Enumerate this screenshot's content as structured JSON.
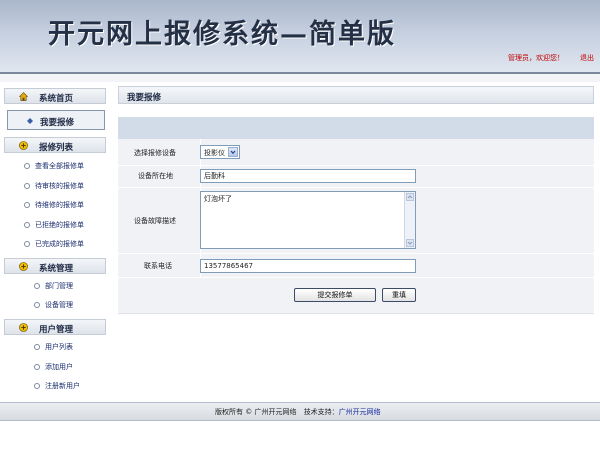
{
  "banner": {
    "title": "开元网上报修系统—简单版",
    "user_text": "管理员，欢迎您！",
    "logout": "退出"
  },
  "sidebar": {
    "home": "系统首页",
    "active": "我要报修",
    "sections": [
      {
        "label": "报修列表",
        "items": [
          "查看全部报修单",
          "待审核的报修单",
          "待维修的报修单",
          "已拒绝的报修单",
          "已完成的报修单"
        ]
      },
      {
        "label": "系统管理",
        "items": [
          "部门管理",
          "设备管理"
        ]
      },
      {
        "label": "用户管理",
        "items": [
          "用户列表",
          "添加用户",
          "注册新用户"
        ]
      }
    ]
  },
  "main": {
    "title": "我要报修",
    "form": {
      "device_label": "选择报修设备",
      "device_value": "投影仪",
      "location_label": "设备所在地",
      "location_value": "后勤科",
      "desc_label": "设备故障描述",
      "desc_value": "灯泡坏了",
      "phone_label": "联系电话",
      "phone_value": "13577865467",
      "submit": "提交报修单",
      "reset": "重填"
    }
  },
  "footer": {
    "copyright": "版权所有 © 广州开元网络",
    "support_label": "技术支持：",
    "support_link": "广州开元网络"
  },
  "colors": {
    "banner_title": "#243046",
    "alert_red": "#c00000",
    "link_blue": "#1a2c9e",
    "form_bg": "#f0f2f5",
    "form_header_bg": "#d2dbe8"
  }
}
